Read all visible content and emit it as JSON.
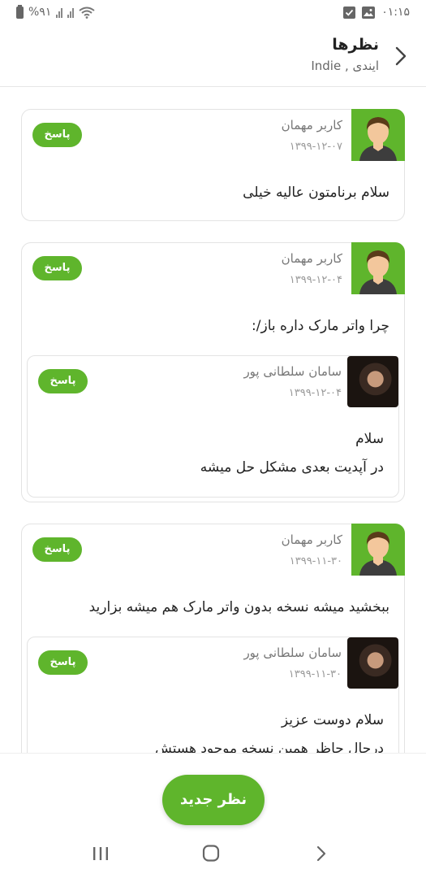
{
  "status_bar": {
    "time": "۰۱:۱۵",
    "battery": "%۹۱"
  },
  "header": {
    "title": "نظرها",
    "subtitle": "ایندی , Indie"
  },
  "comments": [
    {
      "author": "کاربر مهمان",
      "date": "۱۳۹۹-۱۲-۰۷",
      "text": "سلام برنامتون عالیه خیلی",
      "reply_label": "پاسخ",
      "replies": []
    },
    {
      "author": "کاربر مهمان",
      "date": "۱۳۹۹-۱۲-۰۴",
      "text": "چرا واتر مارک داره باز/:",
      "reply_label": "پاسخ",
      "replies": [
        {
          "author": "سامان سلطانی پور",
          "date": "۱۳۹۹-۱۲-۰۴",
          "lines": [
            "سلام",
            "در آپدیت بعدی مشکل حل میشه"
          ],
          "reply_label": "پاسخ"
        }
      ]
    },
    {
      "author": "کاربر مهمان",
      "date": "۱۳۹۹-۱۱-۳۰",
      "text": "ببخشید میشه نسخه بدون واتر مارک هم میشه بزارید",
      "reply_label": "پاسخ",
      "replies": [
        {
          "author": "سامان سلطانی پور",
          "date": "۱۳۹۹-۱۱-۳۰",
          "lines": [
            "سلام دوست عزیز",
            "درحال حاظر همین نسخه موجود هستش"
          ],
          "reply_label": "پاسخ"
        }
      ]
    }
  ],
  "new_comment_button": "نظر جدید",
  "colors": {
    "accent": "#5fb52c"
  }
}
